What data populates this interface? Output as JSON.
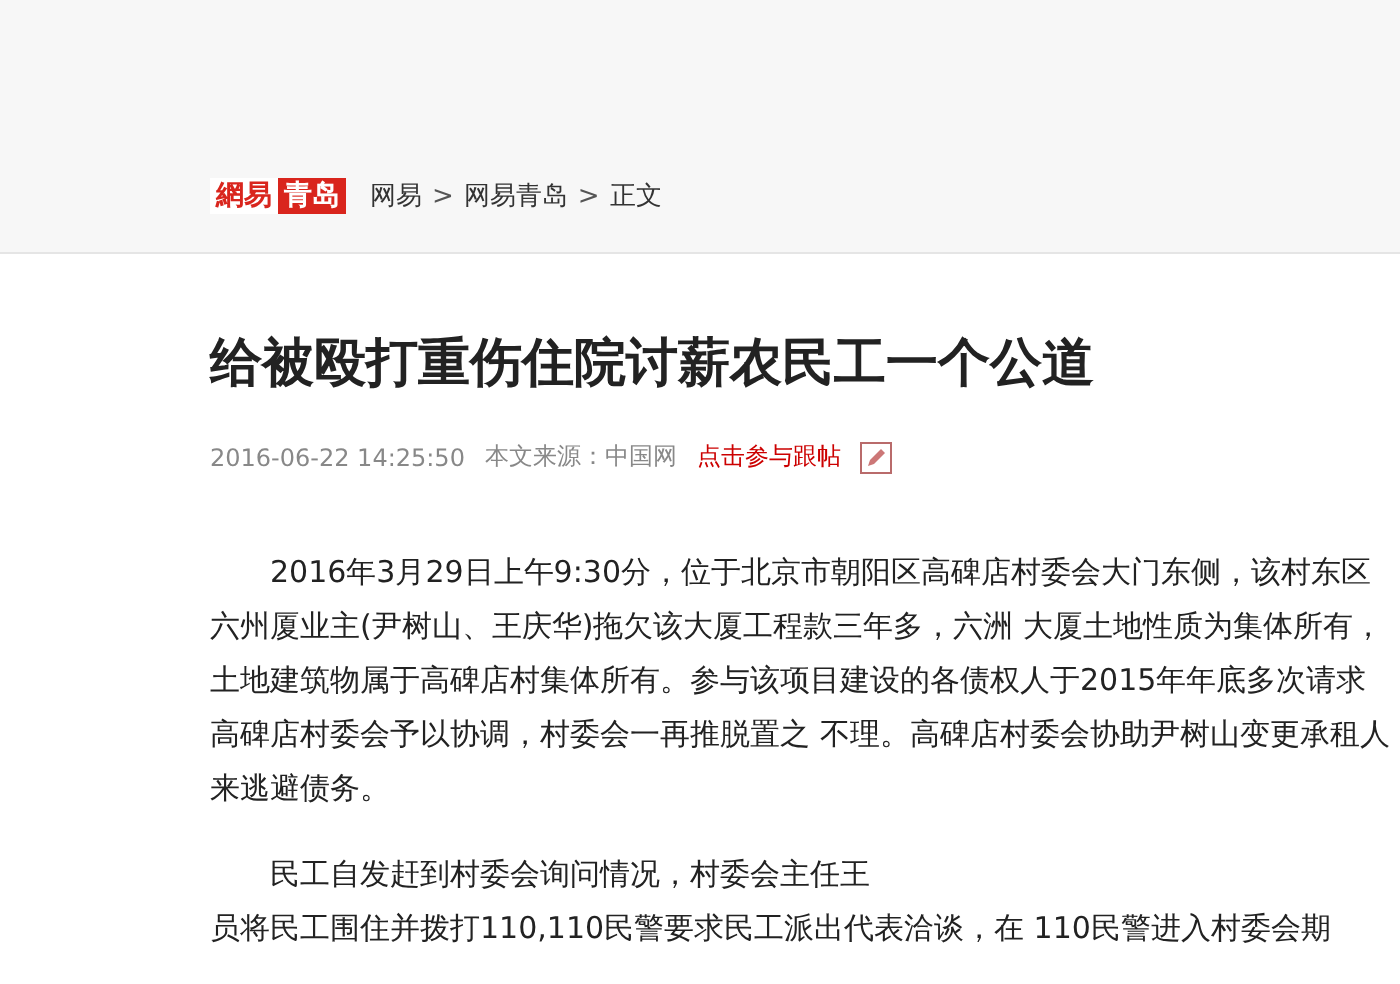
{
  "header": {
    "logo": {
      "brand": "網易",
      "site": "青岛"
    },
    "breadcrumb": [
      {
        "label": "网易"
      },
      {
        "label": "网易青岛"
      },
      {
        "label": "正文"
      }
    ],
    "separator": ">"
  },
  "article": {
    "title": "给被殴打重伤住院讨薪农民工一个公道",
    "date": "2016-06-22 14:25:50",
    "source": "本文来源：中国网",
    "comment_link": "点击参与跟帖",
    "paragraphs": [
      {
        "lines": [
          "2016年3月29日上午9:30分，位于北京市朝阳区高碑店村委会大门东侧，该村东区六州厦业主(尹树山、王庆华)拖欠该大厦工程款三年多，六洲 大厦土地性质为集体所有，土地建筑物属于高碑店村集体所有。参与该项目建设的各债权人于2015年年底多次请求高碑店村委会予以协调，村委会一再推脱置之 不理。高碑店村委会协助尹树山变更承租人来逃避债务。"
        ]
      },
      {
        "lines": [
          "民工自发赶到村委会询问情况，村委会主任王",
          "员将民工围住并拨打110,110民警要求民工派出代表洽谈，在 110民警进入村委会期"
        ]
      }
    ]
  }
}
